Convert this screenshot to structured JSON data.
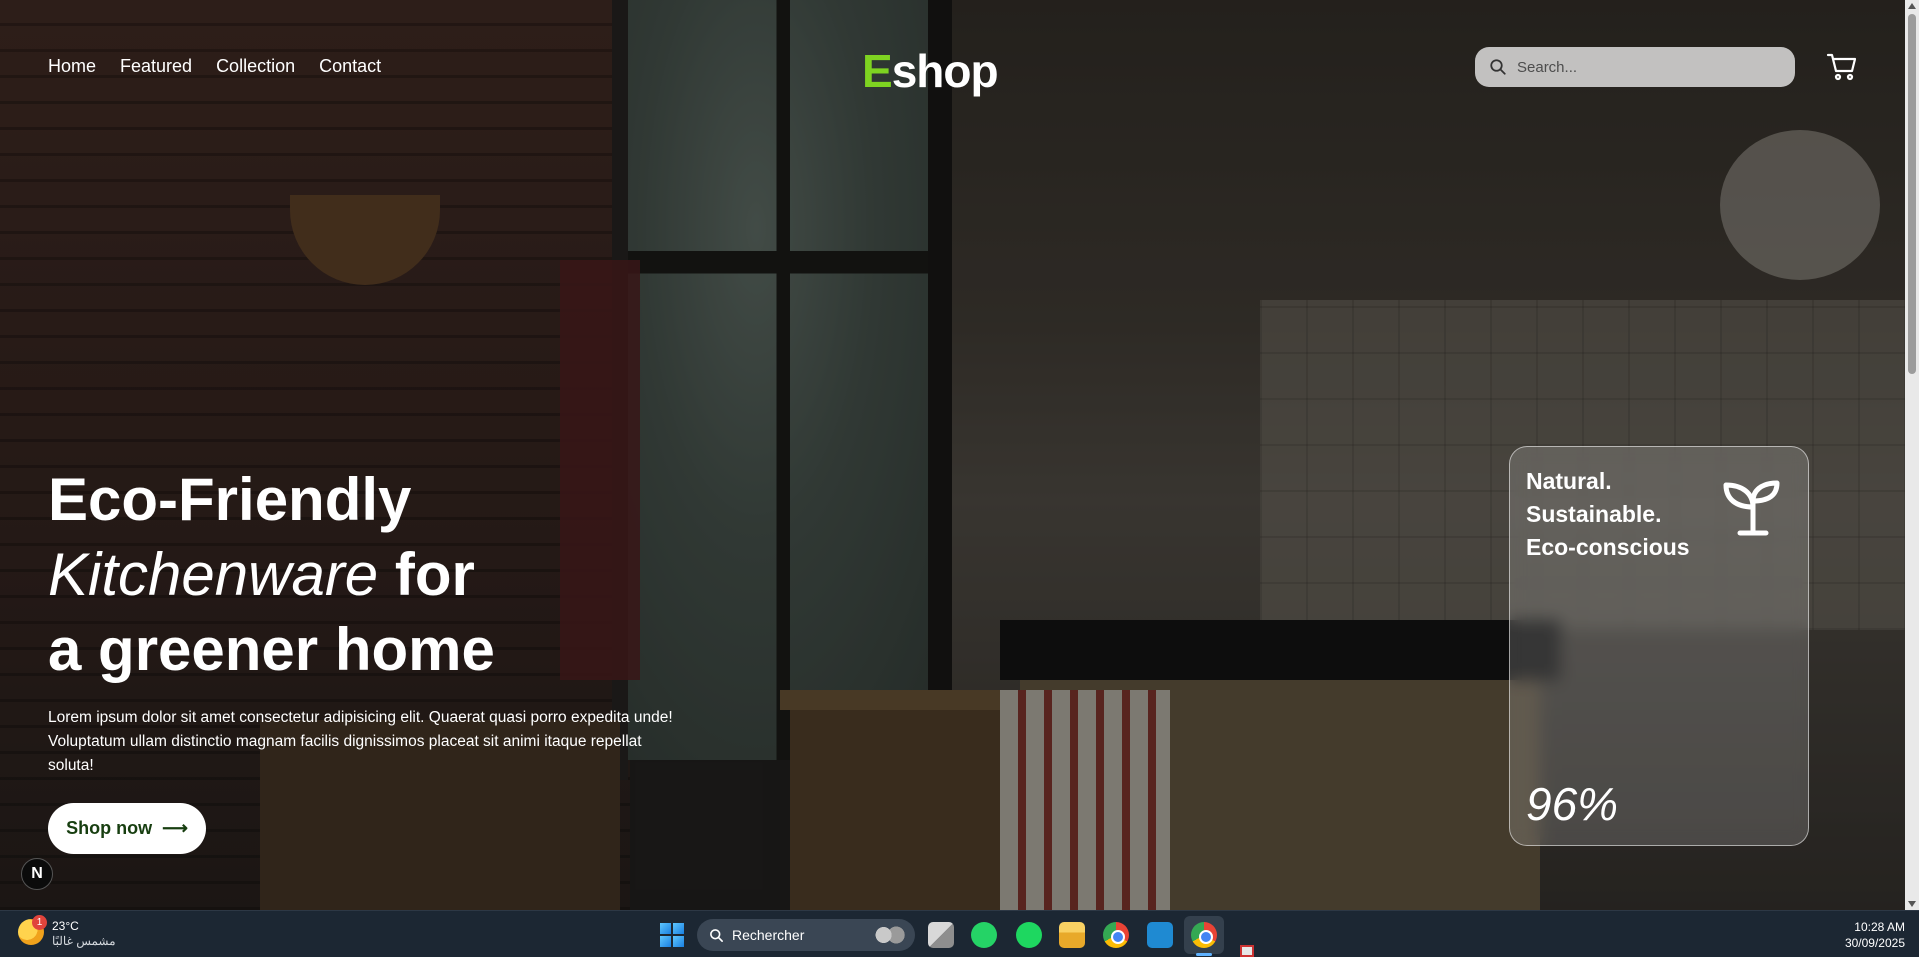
{
  "nav": {
    "links": [
      "Home",
      "Featured",
      "Collection",
      "Contact"
    ]
  },
  "logo": {
    "first_letter": "E",
    "rest": "shop",
    "accent_color": "#7ed321"
  },
  "search": {
    "placeholder": "Search...",
    "icon": "search-icon"
  },
  "cart": {
    "icon": "cart-icon"
  },
  "hero": {
    "headline_line1": "Eco-Friendly",
    "headline_line2_italic": "Kitchenware",
    "headline_line2_rest": " for",
    "headline_line3": "a greener home",
    "description": "Lorem ipsum dolor sit amet consectetur adipisicing elit. Quaerat quasi porro expedita unde! Voluptatum ullam distinctio magnam facilis dignissimos placeat sit animi itaque repellat soluta!",
    "cta_label": "Shop now",
    "cta_arrow": "⟶",
    "cta_text_color": "#173e10"
  },
  "card": {
    "lines": [
      "Natural.",
      "Sustainable.",
      "Eco-conscious"
    ],
    "icon": "sprout-icon",
    "percent": "96%"
  },
  "dev_badge": {
    "letter": "N"
  },
  "taskbar": {
    "weather_temp": "23°C",
    "weather_desc": "مشمس غالبًا",
    "weather_badge": "1",
    "search_label": "Rechercher",
    "apps": [
      "task-view",
      "whatsapp",
      "spotify",
      "file-explorer",
      "chrome",
      "vscode",
      "chrome-profile"
    ],
    "time": "10:28 AM",
    "date": "30/09/2025"
  }
}
